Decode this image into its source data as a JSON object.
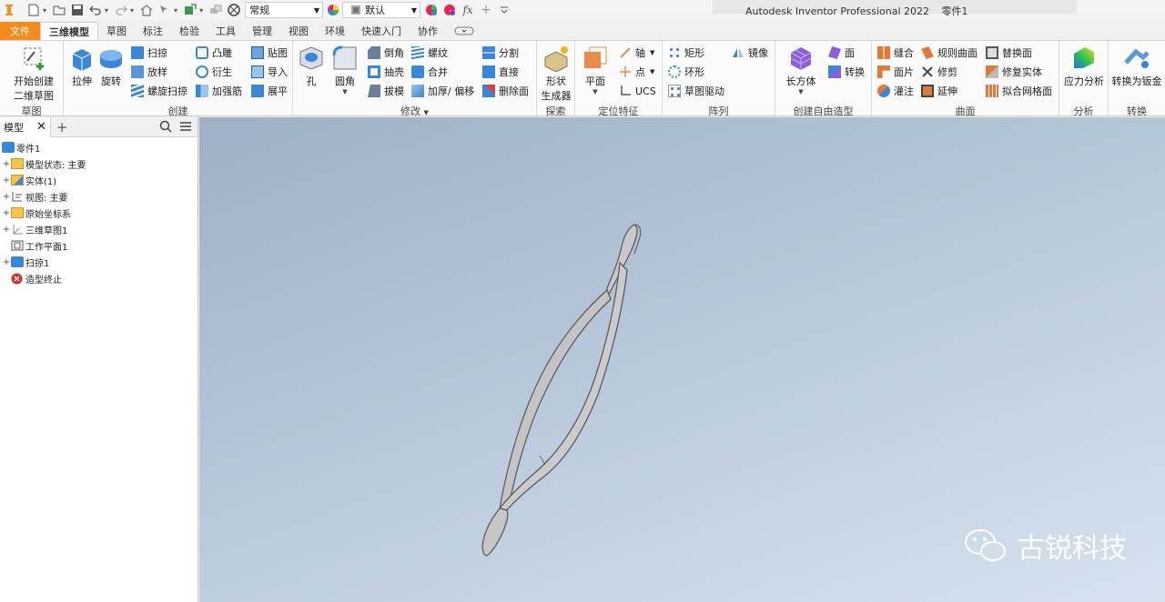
{
  "qat": {
    "style_value": "常规",
    "material_value": "默认"
  },
  "title": {
    "app": "Autodesk Inventor Professional 2022",
    "document": "零件1"
  },
  "tabs": [
    {
      "label": "文件"
    },
    {
      "label": "三维模型"
    },
    {
      "label": "草图"
    },
    {
      "label": "标注"
    },
    {
      "label": "检验"
    },
    {
      "label": "工具"
    },
    {
      "label": "管理"
    },
    {
      "label": "视图"
    },
    {
      "label": "环境"
    },
    {
      "label": "快速入门"
    },
    {
      "label": "协作"
    }
  ],
  "ribbon": {
    "sketch": {
      "start_line1": "开始创建",
      "start_line2": "二维草图",
      "title": "草图"
    },
    "create": {
      "extrude": "拉伸",
      "revolve": "旋转",
      "sweep": "扫掠",
      "loft": "放样",
      "coil": "螺旋扫掠",
      "emboss": "凸雕",
      "derive": "衍生",
      "rib": "加强筋",
      "decal": "贴图",
      "import": "导入",
      "unwrap": "展平",
      "title": "创建"
    },
    "modify": {
      "hole": "孔",
      "fillet": "圆角",
      "chamfer": "倒角",
      "shell": "抽壳",
      "draft": "拔模",
      "thread": "螺纹",
      "combine": "合并",
      "thicken": "加厚/ 偏移",
      "split": "分割",
      "direct": "直接",
      "delete_face": "删除面",
      "title": "修改"
    },
    "explore": {
      "shape_gen_line1": "形状",
      "shape_gen_line2": "生成器",
      "title": "探索"
    },
    "work": {
      "plane": "平面",
      "axis": "轴",
      "point": "点",
      "ucs": "UCS",
      "title": "定位特征"
    },
    "pattern": {
      "rect": "矩形",
      "circ": "环形",
      "sketch_driven": "草图驱动",
      "mirror": "镜像",
      "title": "阵列"
    },
    "freeform": {
      "box": "长方体",
      "face": "面",
      "convert": "转换",
      "title": "创建自由造型"
    },
    "surface": {
      "stitch": "缝合",
      "patch": "面片",
      "sculpt": "灌注",
      "ruled": "规则曲面",
      "trim": "修剪",
      "extend": "延伸",
      "replace": "替换面",
      "repair": "修复实体",
      "fit_mesh": "拟合网格面",
      "title": "曲面"
    },
    "analysis": {
      "stress": "应力分析",
      "title": "分析"
    },
    "convert": {
      "sheetmetal": "转换为钣金",
      "title": "转换"
    }
  },
  "browser": {
    "tab_label": "模型",
    "nodes": [
      {
        "label": "零件1"
      },
      {
        "label": "模型状态: 主要"
      },
      {
        "label": "实体(1)"
      },
      {
        "label": "视图: 主要"
      },
      {
        "label": "原始坐标系"
      },
      {
        "label": "三维草图1"
      },
      {
        "label": "工作平面1"
      },
      {
        "label": "扫掠1"
      },
      {
        "label": "造型终止"
      }
    ]
  },
  "watermark": {
    "text": "古锐科技"
  },
  "colors": {
    "file_tab": "#f28c1c",
    "viewport_top": "#9fb0c6",
    "viewport_bottom": "#d6e2ef"
  }
}
